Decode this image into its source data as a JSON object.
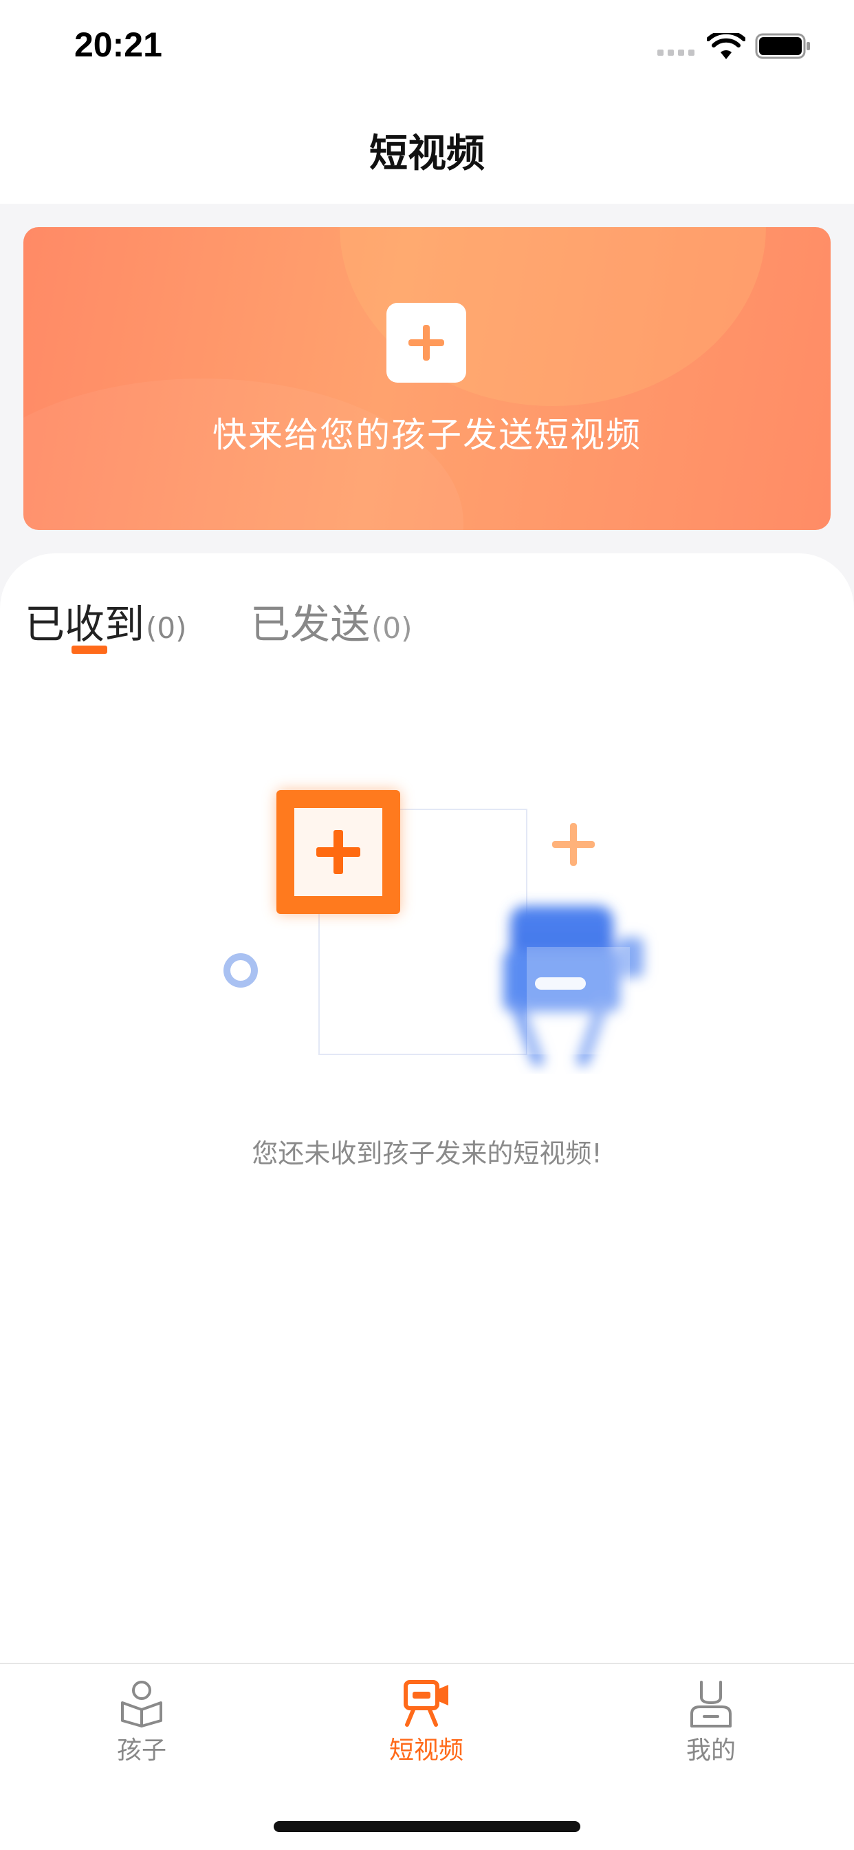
{
  "status_bar": {
    "time": "20:21",
    "icons": [
      "signal-dots-icon",
      "wifi-icon",
      "battery-icon"
    ]
  },
  "nav": {
    "title": "短视频"
  },
  "banner": {
    "text": "快来给您的孩子发送短视频",
    "icon": "plus-icon",
    "colors": {
      "gradient_start": "#ff8a66",
      "gradient_mid": "#ffa26e",
      "plus": "#ff9a5a"
    }
  },
  "tabs": [
    {
      "label": "已收到",
      "count": "(0)",
      "active": true
    },
    {
      "label": "已发送",
      "count": "(0)",
      "active": false
    }
  ],
  "empty_state": {
    "message": "您还未收到孩子发来的短视频!",
    "illustration": "empty-video-illustration"
  },
  "tab_bar": {
    "items": [
      {
        "label": "孩子",
        "icon": "child-reading-icon",
        "active": false
      },
      {
        "label": "短视频",
        "icon": "video-camera-icon",
        "active": true
      },
      {
        "label": "我的",
        "icon": "profile-icon",
        "active": false
      }
    ]
  },
  "colors": {
    "accent": "#ff6a1a",
    "inactive": "#888888",
    "background": "#f5f5f7"
  }
}
